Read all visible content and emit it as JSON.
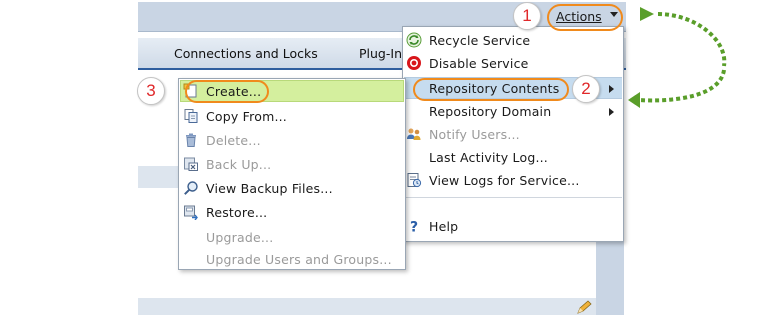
{
  "header": {
    "actions_label": "Actions"
  },
  "tabs": {
    "connections": "Connections and Locks",
    "plugins": "Plug-In"
  },
  "actions_menu": {
    "items": [
      {
        "label": "Recycle Service",
        "icon": "recycle-icon",
        "enabled": true
      },
      {
        "label": "Disable Service",
        "icon": "disable-icon",
        "enabled": true
      },
      {
        "label": "Repository Contents",
        "icon": "",
        "enabled": true,
        "submenu": true,
        "highlighted": true
      },
      {
        "label": "Repository Domain",
        "icon": "",
        "enabled": true,
        "submenu": true
      },
      {
        "label": "Notify Users...",
        "icon": "users-icon",
        "enabled": false
      },
      {
        "label": "Last Activity Log...",
        "icon": "",
        "enabled": true
      },
      {
        "label": "View Logs for Service...",
        "icon": "log-icon",
        "enabled": true
      },
      {
        "label": "Help",
        "icon": "help-icon",
        "enabled": true
      }
    ]
  },
  "repository_submenu": {
    "items": [
      {
        "label": "Create...",
        "icon": "create-icon",
        "enabled": true,
        "highlighted": true
      },
      {
        "label": "Copy From...",
        "icon": "copy-icon",
        "enabled": true
      },
      {
        "label": "Delete...",
        "icon": "trash-icon",
        "enabled": false
      },
      {
        "label": "Back Up...",
        "icon": "backup-icon",
        "enabled": false
      },
      {
        "label": "View Backup Files...",
        "icon": "magnifier-icon",
        "enabled": true
      },
      {
        "label": "Restore...",
        "icon": "restore-icon",
        "enabled": true
      },
      {
        "label": "Upgrade...",
        "icon": "",
        "enabled": false
      },
      {
        "label": "Upgrade Users and Groups...",
        "icon": "",
        "enabled": false
      }
    ]
  },
  "callouts": {
    "step1": "1",
    "step2": "2",
    "step3": "3"
  },
  "colors": {
    "callout_orange": "#f08a1c",
    "callout_number_red": "#e0282a",
    "flow_arrow_green": "#5a9e2a",
    "submenu_highlight": "#d4ef9e",
    "menu_highlight": "#c6dcef"
  }
}
